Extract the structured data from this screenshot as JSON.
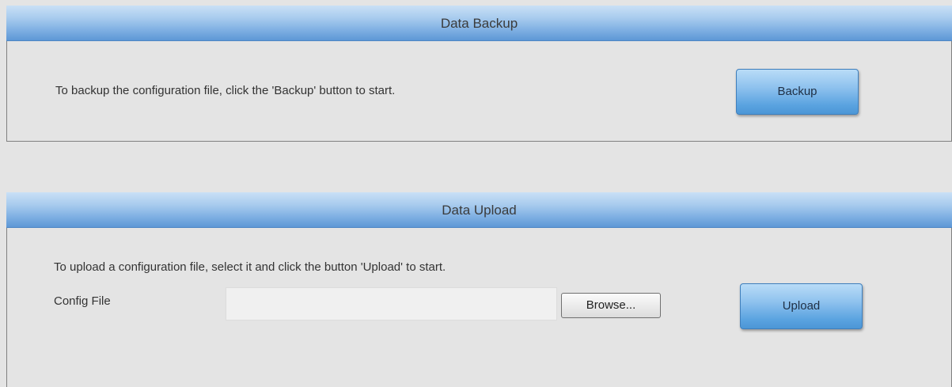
{
  "backup": {
    "title": "Data Backup",
    "description": "To backup the configuration file, click the 'Backup' button to start.",
    "button_label": "Backup"
  },
  "upload": {
    "title": "Data Upload",
    "description": "To upload a configuration file, select it and click the button 'Upload' to start.",
    "field_label": "Config File",
    "file_value": "",
    "browse_label": "Browse...",
    "button_label": "Upload"
  },
  "colors": {
    "header_gradient_top": "#c9e0f6",
    "header_gradient_bottom": "#5d97d6",
    "button_blue": "#5aa3e0",
    "page_background": "#e4e4e4"
  }
}
